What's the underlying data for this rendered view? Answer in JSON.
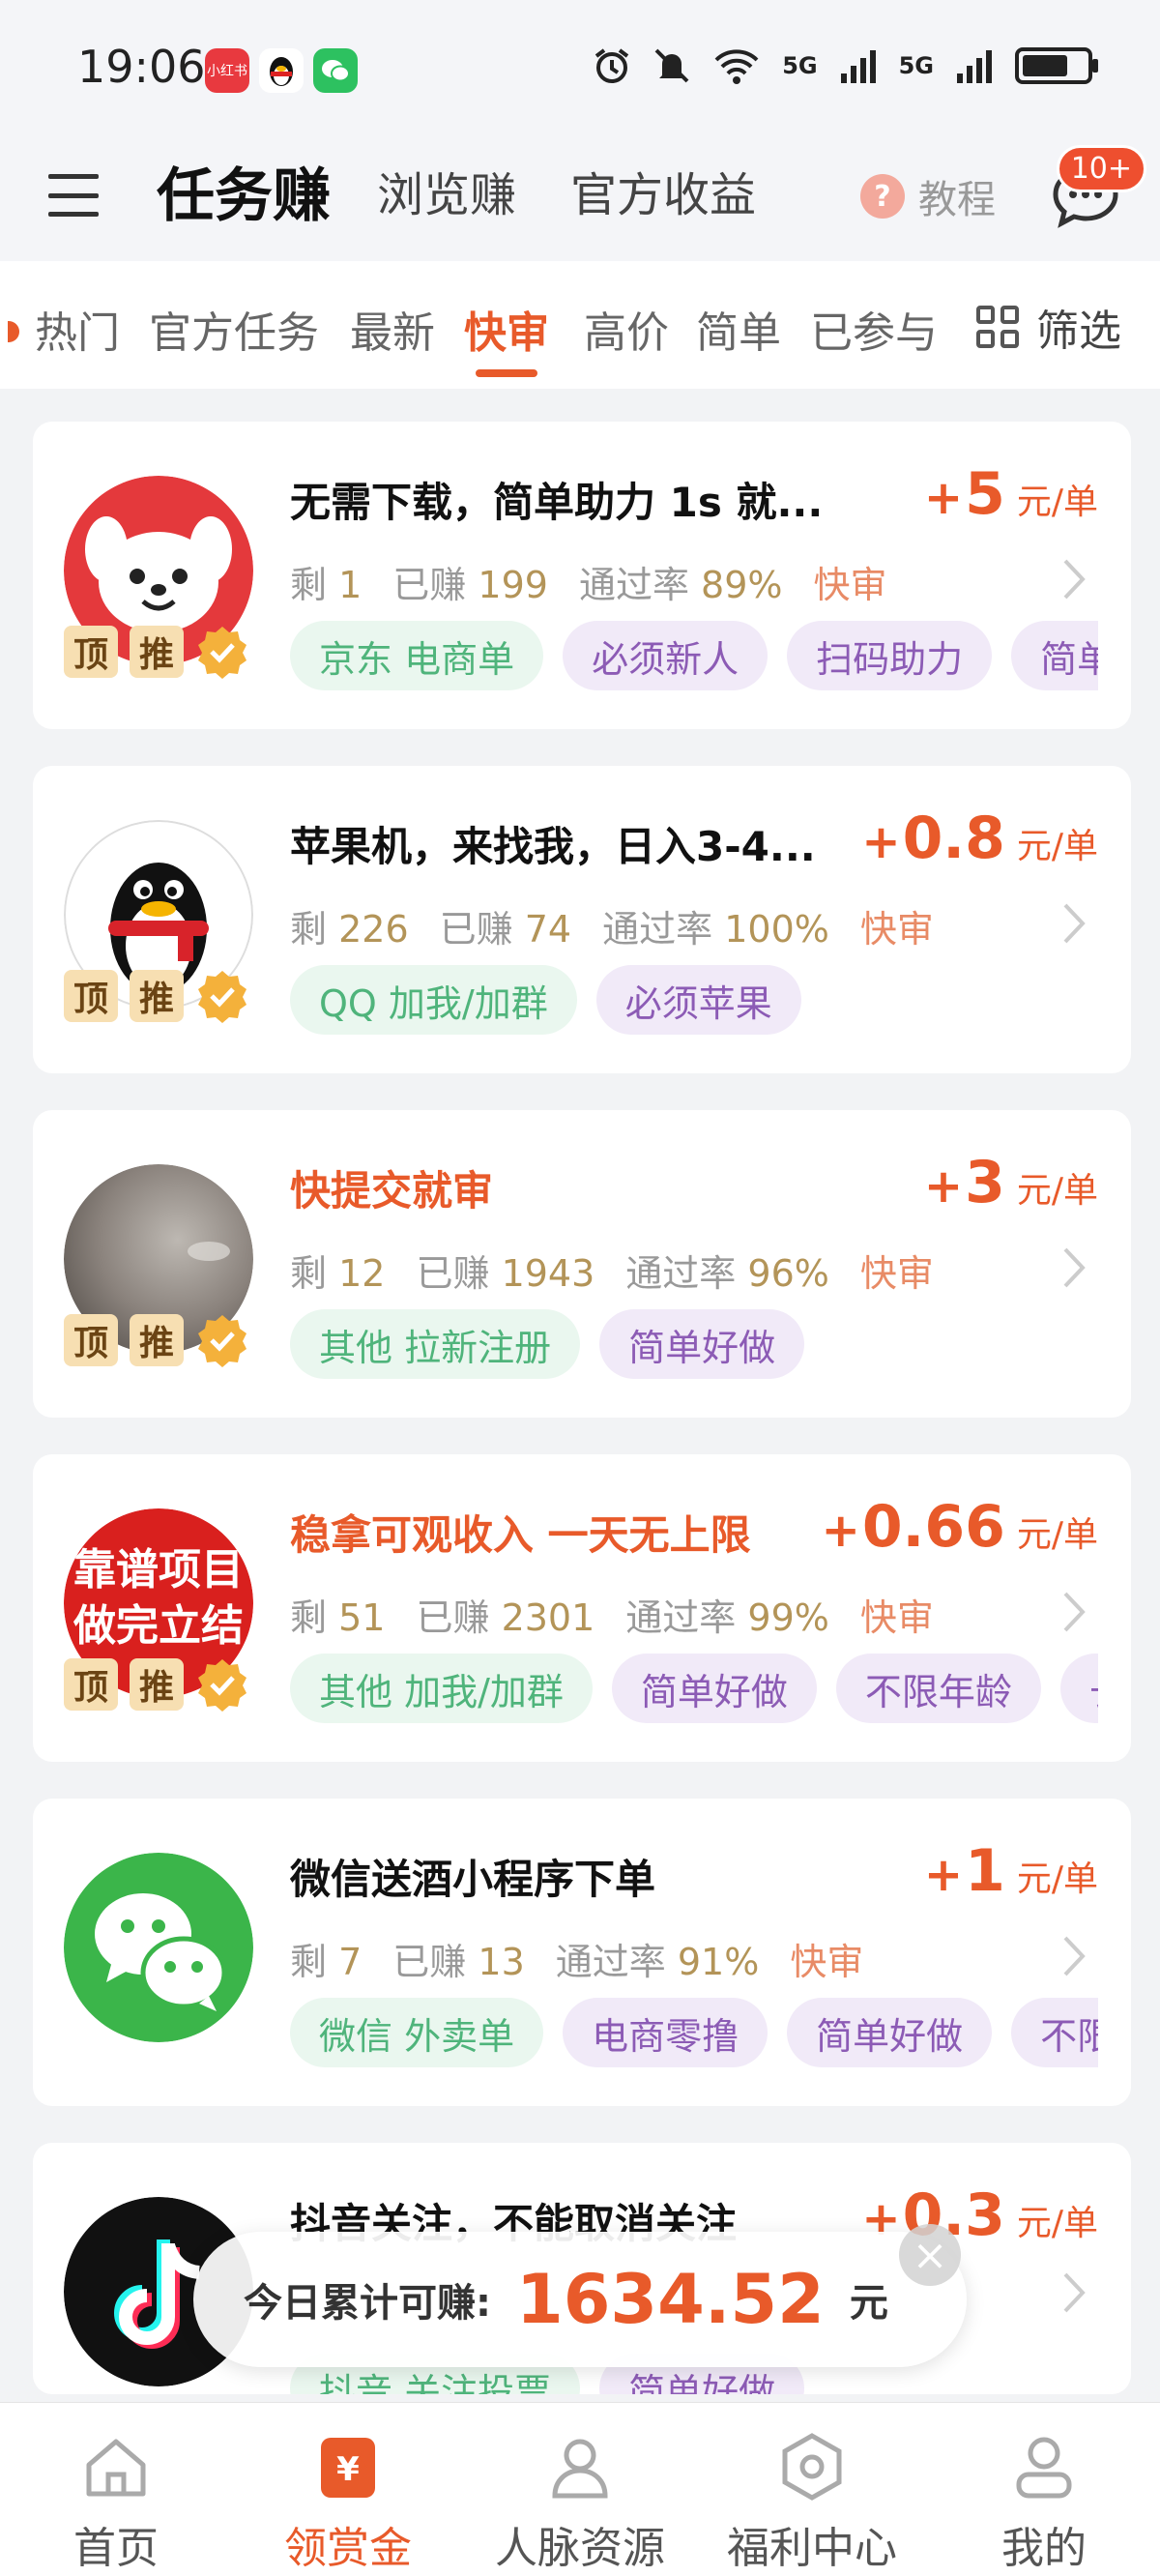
{
  "status_bar": {
    "time": "19:06",
    "signal_1": "5G",
    "signal_2": "5G",
    "battery_level": 0.72
  },
  "header": {
    "tabs": [
      "任务赚",
      "浏览赚",
      "官方收益"
    ],
    "active_tab": "任务赚",
    "tutorial_label": "教程",
    "message_badge": "10+"
  },
  "subtabs": {
    "items": [
      "热门",
      "官方任务",
      "最新",
      "快审",
      "高价",
      "简单",
      "已参与"
    ],
    "active": "快审",
    "filter_label": "筛选"
  },
  "labels": {
    "remaining": "剩",
    "earned": "已赚",
    "pass_rate": "通过率",
    "fast_review": "快审",
    "price_unit": "元/单",
    "top": "顶",
    "push": "推"
  },
  "tasks": [
    {
      "title": "无需下载，简单助力 1s 就...",
      "price": "5",
      "remaining": "1",
      "earned": "199",
      "pass_rate": "89%",
      "tags": [
        "京东 电商单",
        "必须新人",
        "扫码助力",
        "简单好做"
      ],
      "avatar": "jd-dog-icon",
      "highlight_title": false
    },
    {
      "title": "苹果机，来找我，日入3-4...",
      "price": "0.8",
      "remaining": "226",
      "earned": "74",
      "pass_rate": "100%",
      "tags": [
        "QQ 加我/加群",
        "必须苹果"
      ],
      "avatar": "qq-penguin-icon",
      "highlight_title": false
    },
    {
      "title": "快提交就审",
      "price": "3",
      "remaining": "12",
      "earned": "1943",
      "pass_rate": "96%",
      "tags": [
        "其他 拉新注册",
        "简单好做"
      ],
      "avatar": "gray-photo-avatar",
      "highlight_title": true
    },
    {
      "title": "稳拿可观收入 一天无上限",
      "price": "0.66",
      "remaining": "51",
      "earned": "2301",
      "pass_rate": "99%",
      "tags": [
        "其他 加我/加群",
        "简单好做",
        "不限年龄",
        "长期"
      ],
      "avatar": "red-text-avatar",
      "avatar_text": [
        "靠谱项目",
        "做完立结"
      ],
      "highlight_title": true
    },
    {
      "title": "微信送酒小程序下单",
      "price": "1",
      "remaining": "7",
      "earned": "13",
      "pass_rate": "91%",
      "tags": [
        "微信 外卖单",
        "电商零撸",
        "简单好做",
        "不限年龄"
      ],
      "avatar": "wechat-icon",
      "highlight_title": false
    },
    {
      "title": "抖音关注，不能取消关注",
      "price": "0.3",
      "remaining": "",
      "earned": "",
      "pass_rate": "",
      "tags": [
        "抖音 关注投票",
        "简单好做"
      ],
      "avatar": "tiktok-icon",
      "highlight_title": false
    }
  ],
  "earnings": {
    "label": "今日累计可赚:",
    "amount": "1634.52",
    "unit": "元"
  },
  "bottom_nav": {
    "items": [
      "首页",
      "领赏金",
      "人脉资源",
      "福利中心",
      "我的"
    ],
    "active": "领赏金"
  },
  "colors": {
    "accent": "#e85a2a",
    "tag_green": "#4fb47b",
    "tag_purple": "#8c5bb5",
    "meta_number": "#b39458"
  }
}
